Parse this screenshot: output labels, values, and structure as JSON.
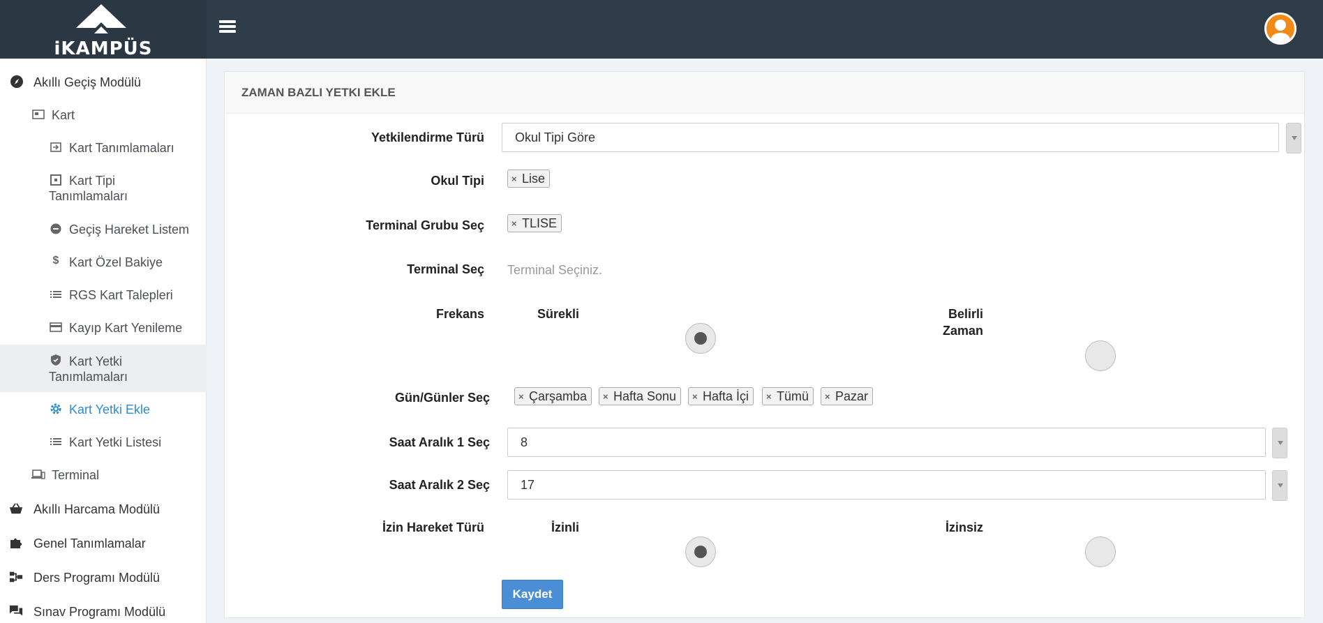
{
  "header": {
    "logo_text": "iKAMPÜS",
    "menu_icon": "hamburger-icon",
    "avatar_icon": "user-avatar-icon"
  },
  "sidebar": {
    "items": [
      {
        "label": "Akıllı Geçiş Modülü",
        "icon": "compass-icon"
      },
      {
        "label": "Kart",
        "icon": "card-icon"
      },
      {
        "label": "Kart Tanımlamaları",
        "icon": "login-icon"
      },
      {
        "label": "Kart Tipi Tanımlamaları",
        "icon": "grid-icon"
      },
      {
        "label": "Geçiş Hareket Listem",
        "icon": "minus-circle-icon"
      },
      {
        "label": "Kart Özel Bakiye",
        "icon": "dollar-icon"
      },
      {
        "label": "RGS Kart Talepleri",
        "icon": "list-icon"
      },
      {
        "label": "Kayıp Kart Yenileme",
        "icon": "credit-card-icon"
      },
      {
        "label": "Kart Yetki Tanımlamaları",
        "icon": "shield-icon"
      },
      {
        "label": "Kart Yetki Ekle",
        "icon": "gear-icon"
      },
      {
        "label": "Kart Yetki Listesi",
        "icon": "list-icon"
      },
      {
        "label": "Terminal",
        "icon": "devices-icon"
      },
      {
        "label": "Akıllı Harcama Modülü",
        "icon": "basket-icon"
      },
      {
        "label": "Genel Tanımlamalar",
        "icon": "puzzle-icon"
      },
      {
        "label": "Ders Programı Modülü",
        "icon": "sitemap-icon"
      },
      {
        "label": "Sınav Programı Modülü",
        "icon": "chat-icon"
      }
    ]
  },
  "form": {
    "title": "ZAMAN BAZLI YETKI EKLE",
    "yetki_turu": {
      "label": "Yetkilendirme Türü",
      "value": "Okul Tipi Göre"
    },
    "okul_tipi": {
      "label": "Okul Tipi",
      "tags": [
        "Lise"
      ]
    },
    "terminal_grubu": {
      "label": "Terminal Grubu Seç",
      "tags": [
        "TLISE"
      ]
    },
    "terminal": {
      "label": "Terminal Seç",
      "placeholder": "Terminal Seçiniz."
    },
    "frekans": {
      "label": "Frekans",
      "option1": "Sürekli",
      "option2_line1": "Belirli",
      "option2_line2": "Zaman",
      "selected": "Sürekli"
    },
    "gunler": {
      "label": "Gün/Günler Seç",
      "tags": [
        "Çarşamba",
        "Hafta Sonu",
        "Hafta İçi",
        "Tümü",
        "Pazar"
      ]
    },
    "saat1": {
      "label": "Saat Aralık 1 Seç",
      "value": "8"
    },
    "saat2": {
      "label": "Saat Aralık 2 Seç",
      "value": "17"
    },
    "izin": {
      "label": "İzin Hareket Türü",
      "option1": "İzinli",
      "option2": "İzinsiz",
      "selected": "İzinli"
    },
    "submit": "Kaydet",
    "remove_mark": "×"
  }
}
